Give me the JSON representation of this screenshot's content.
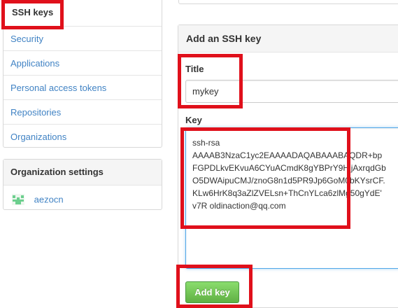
{
  "sidebar": {
    "items": [
      {
        "label": "SSH keys",
        "selected": true
      },
      {
        "label": "Security"
      },
      {
        "label": "Applications"
      },
      {
        "label": "Personal access tokens"
      },
      {
        "label": "Repositories"
      },
      {
        "label": "Organizations"
      }
    ]
  },
  "org_settings": {
    "heading": "Organization settings",
    "org_name": "aezocn",
    "avatar_icon": "identicon-avatar"
  },
  "form": {
    "heading": "Add an SSH key",
    "title_label": "Title",
    "title_value": "mykey",
    "key_label": "Key",
    "key_lines": [
      "ssh-rsa",
      "AAAAB3NzaC1yc2EAAAADAQABAAABAQDR+bp",
      "FGPDLkvEKvuA6CYuACmdK8gYBPrY9HjjAxrqdGb",
      "O5DWAipuCMJ/znoG8n1d5PR9Jp6GoM0bKYsrCF.",
      "KLw6HrK8q3aZlZVELsn+ThCnYLca6zlMg50gYdE'",
      "v7R oldinaction@qq.com"
    ],
    "submit_label": "Add key"
  },
  "colors": {
    "link": "#4183c4",
    "accent_selected": "#d26911",
    "button_green": "#60b044",
    "highlight_red": "#e0101b",
    "focus_blue": "#51a7e8"
  }
}
